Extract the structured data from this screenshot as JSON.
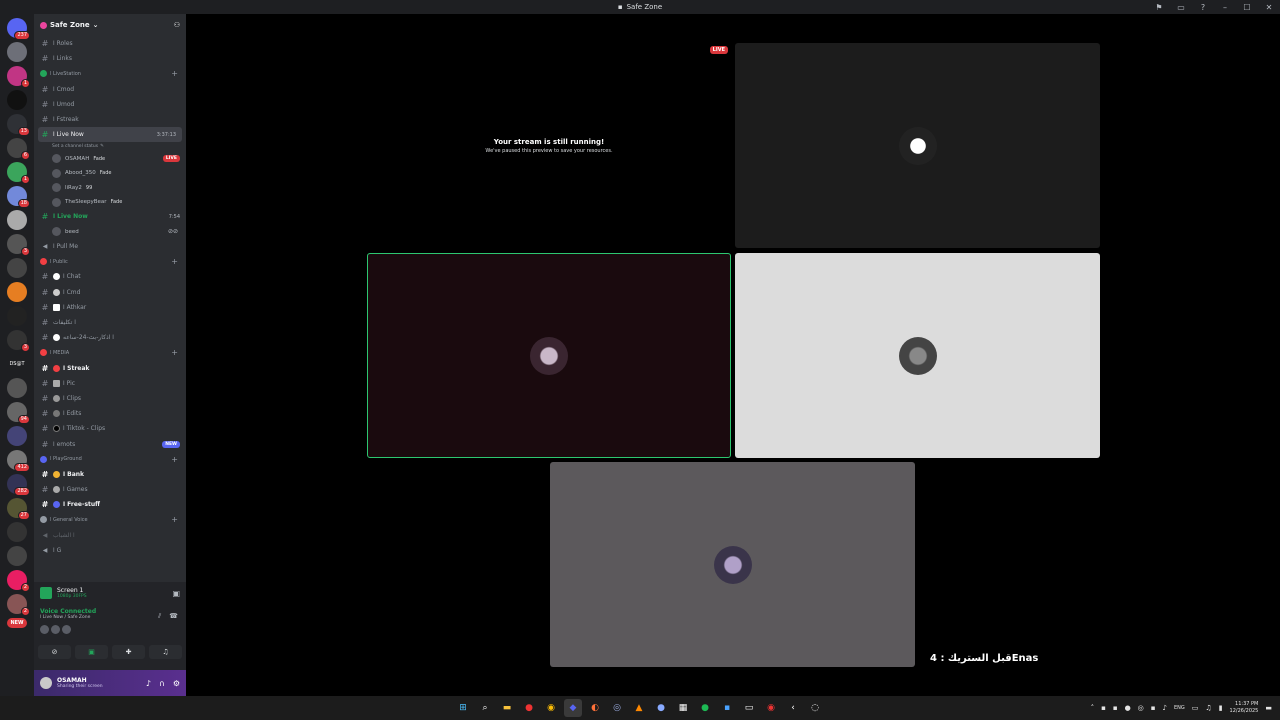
{
  "window": {
    "title": "Safe Zone"
  },
  "rail": {
    "servers": [
      {
        "badge": "237"
      },
      {
        "badge": ""
      },
      {
        "badge": "1"
      },
      {
        "badge": ""
      },
      {
        "badge": "13"
      },
      {
        "badge": "6"
      },
      {
        "badge": "1"
      },
      {
        "badge": "18"
      },
      {
        "badge": ""
      },
      {
        "badge": "3"
      },
      {
        "badge": ""
      },
      {
        "badge": ""
      },
      {
        "badge": ""
      },
      {
        "badge": "3"
      },
      {
        "badge": ""
      },
      {
        "badge": "94"
      },
      {
        "badge": ""
      },
      {
        "badge": "412"
      },
      {
        "badge": "282"
      },
      {
        "badge": "27"
      },
      {
        "badge": ""
      },
      {
        "badge": ""
      },
      {
        "badge": "2"
      },
      {
        "badge": "2"
      }
    ],
    "new_label": "NEW",
    "dsat_label": "DS@T"
  },
  "server": {
    "name": "Safe Zone"
  },
  "channels": {
    "roles": "ا Roles",
    "links": "ا Links",
    "cat_livestation": "ا LiveStation",
    "cmod": "ا Cmod",
    "umod": "ا Umod",
    "fstreak": "ا Fstreak",
    "live_now_1": "ا Live Now",
    "live_now_1_time": "3:37:13",
    "set_status": "Set a channel status",
    "members_1": [
      {
        "name": "OSAMAH",
        "tag": "Fade",
        "live": "LIVE"
      },
      {
        "name": "Abood_350",
        "tag": "Fade",
        "live": ""
      },
      {
        "name": "liRay2",
        "tag": "99",
        "live": ""
      },
      {
        "name": "TheSleepyBear",
        "tag": "Fade",
        "live": ""
      }
    ],
    "live_now_2": "ا Live Now",
    "live_now_2_time": "7:54",
    "members_2": [
      {
        "name": "beed"
      }
    ],
    "pull_me": "ا Pull Me",
    "cat_public": "ا Public",
    "chat": "ا Chat",
    "cmd": "ا Cmd",
    "athkar": "ا Athkar",
    "takleefat": "ا تكليفات",
    "thakar24": "ا اذكار-بث-24-ساعه",
    "cat_media": "ا MEDIA",
    "streak": "ا Streak",
    "pic": "ا Pic",
    "clips": "ا Clips",
    "edits": "ا Edits",
    "tiktok": "ا Tiktok - Clips",
    "emots": "ا emots",
    "new_badge": "NEW",
    "cat_playground": "ا PlayGround",
    "bank": "ا Bank",
    "games": "ا Games",
    "free_stuff": "ا Free-stuff",
    "cat_general_voice": "ا General Voice",
    "voice_1": "ا الشباب",
    "voice_g": "ا G"
  },
  "stream_panel": {
    "title": "Screen 1",
    "sub": "1080p 30FPS"
  },
  "voice_panel": {
    "status": "Voice Connected",
    "location": "ا Live Now / Safe Zone"
  },
  "user": {
    "name": "OSAMAH",
    "status": "Sharing their screen"
  },
  "stage": {
    "paused_title": "Your stream is still running!",
    "paused_sub": "We've paused this preview to save your resources.",
    "live_label": "LIVE",
    "caption": "قبل الستريك : 4Enas"
  },
  "tray": {
    "lang": "ENG",
    "time": "11:37 PM",
    "date": "12/26/2025"
  },
  "colors": {
    "live_red": "#da373c",
    "voice_green": "#23a55a",
    "blurple": "#5865f2"
  }
}
